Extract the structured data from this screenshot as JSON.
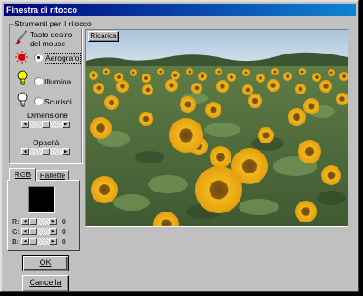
{
  "window": {
    "title": "Finestra di ritocco"
  },
  "tools_group": {
    "label": "Strumenti per il ritocco",
    "mouse_hint": "Tasto destro\ndel mouse",
    "tools": [
      {
        "label": "Aerografo",
        "selected": true,
        "icon": "spray-icon"
      },
      {
        "label": "Illumina",
        "selected": false,
        "icon": "bulb-lit-icon"
      },
      {
        "label": "Scurisci",
        "selected": false,
        "icon": "bulb-dark-icon"
      }
    ],
    "size_label": "Dimensione",
    "opacity_label": "Opacità"
  },
  "color_panel": {
    "tabs": [
      "RGB",
      "Pallette"
    ],
    "active_tab": "RGB",
    "swatch_color": "#000000",
    "channels": [
      {
        "label": "R:",
        "value": "0"
      },
      {
        "label": "G:",
        "value": "0"
      },
      {
        "label": "B:",
        "value": "0"
      }
    ]
  },
  "buttons": {
    "ok": "OK",
    "cancel": "Cancella",
    "reload": "Ricarica"
  },
  "colors": {
    "title_start": "#00007b",
    "title_end": "#1084d0",
    "face": "#c0c0c0"
  }
}
